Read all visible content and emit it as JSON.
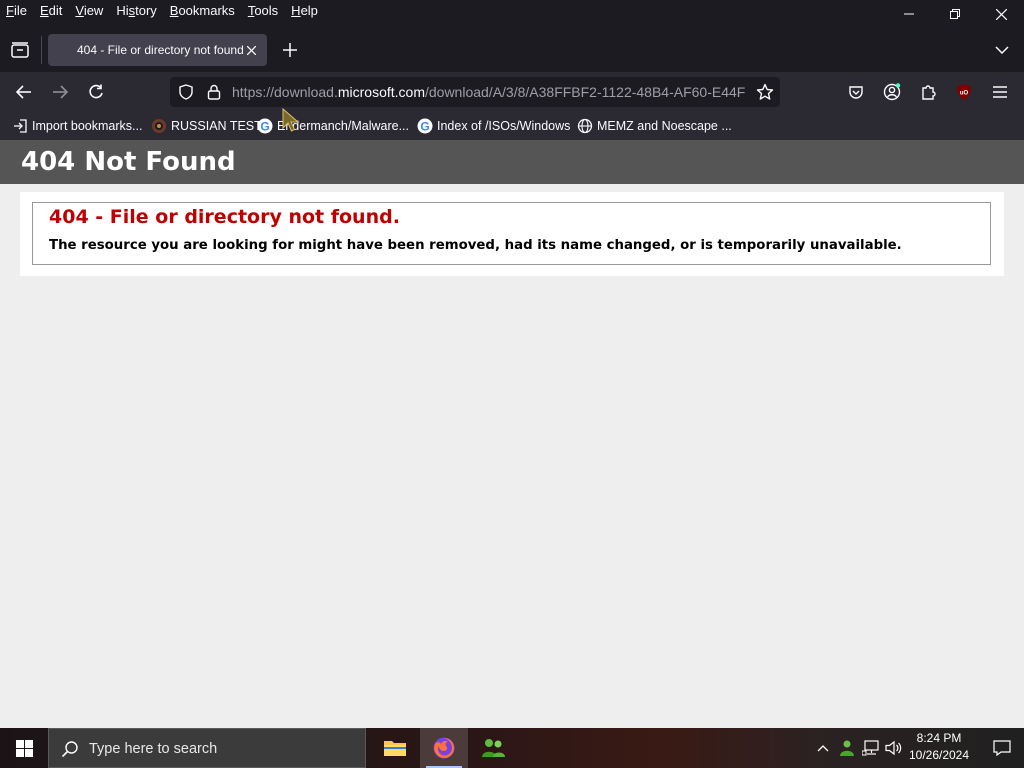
{
  "menubar": {
    "items": [
      {
        "label": "File",
        "access": "F",
        "rest": "ile"
      },
      {
        "label": "Edit",
        "access": "E",
        "rest": "dit"
      },
      {
        "label": "View",
        "access": "V",
        "rest": "iew"
      },
      {
        "label": "History",
        "pre": "Hi",
        "access": "s",
        "rest": "tory"
      },
      {
        "label": "Bookmarks",
        "access": "B",
        "rest": "ookmarks"
      },
      {
        "label": "Tools",
        "access": "T",
        "rest": "ools"
      },
      {
        "label": "Help",
        "access": "H",
        "rest": "elp"
      }
    ]
  },
  "tab": {
    "title": "404 - File or directory not found"
  },
  "urlbar": {
    "url_scheme": "https://download.",
    "url_host": "microsoft.com",
    "url_path": "/download/A/3/8/A38FFBF2-1122-48B4-AF60-E44F"
  },
  "bookmarks": [
    {
      "label": "Import bookmarks...",
      "icon": "import-icon"
    },
    {
      "label": "RUSSIAN TEST",
      "icon": "site-favicon"
    },
    {
      "label": "Endermanch/Malware...",
      "icon": "google-icon"
    },
    {
      "label": "Index of /ISOs/Windows",
      "icon": "google-icon"
    },
    {
      "label": "MEMZ and Noescape ...",
      "icon": "globe-icon"
    }
  ],
  "page": {
    "header": "404 Not Found",
    "error_title": "404 - File or directory not found.",
    "error_description": "The resource you are looking for might have been removed, had its name changed, or is temporarily unavailable."
  },
  "taskbar": {
    "search_placeholder": "Type here to search",
    "time": "8:24 PM",
    "date": "10/26/2024"
  },
  "colors": {
    "browser_chrome": "#1c1b22",
    "toolbar": "#2b2a33",
    "header_bar": "#555555",
    "error_red": "#c00000",
    "page_bg": "#eeeeee"
  }
}
